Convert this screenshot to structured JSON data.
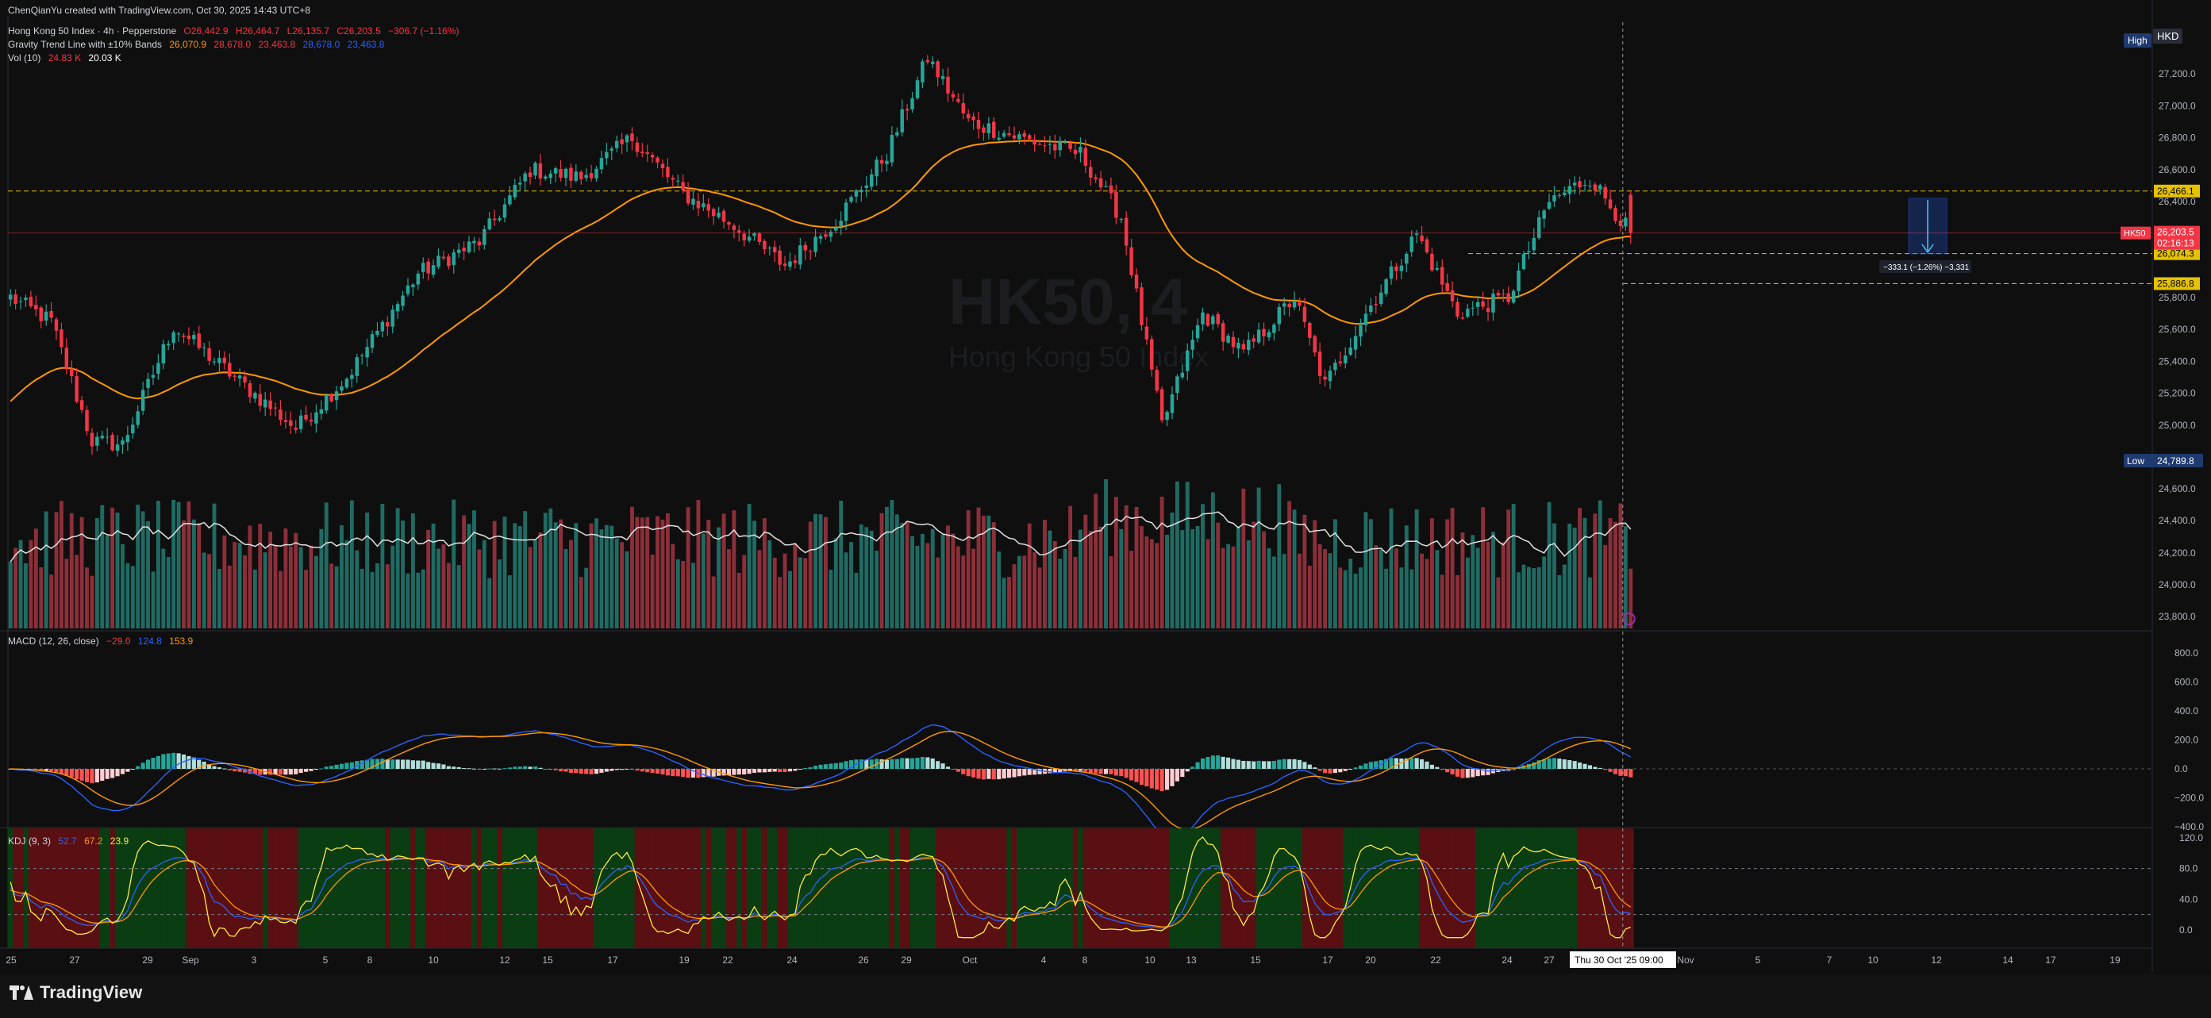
{
  "credit": "ChenQianYu created with TradingView.com, Oct 30, 2025 14:43 UTC+8",
  "brand": "TradingView",
  "header": {
    "symbol_line": "Hong Kong 50 Index · 4h · Pepperstone",
    "ohlc": {
      "o": "O26,442.9",
      "h": "H26,464.7",
      "l": "L26,135.7",
      "c": "C26,203.5",
      "chg": "−306.7 (−1.16%)"
    },
    "gravity_name": "Gravity Trend Line with ±10% Bands",
    "gravity_vals": [
      "26,070.9",
      "28,678.0",
      "23,463.8",
      "28,678.0",
      "23,463.8"
    ],
    "vol_name": "Vol (10)",
    "vol_vals": [
      "24.83 K",
      "20.03 K"
    ],
    "macd_name": "MACD (12, 26, close)",
    "macd_vals": [
      "−29.0",
      "124.8",
      "153.9"
    ],
    "kdj_name": "KDJ (9, 3)",
    "kdj_vals": [
      "52.7",
      "67.2",
      "23.9"
    ]
  },
  "watermark": {
    "symbol": "HK50, 4",
    "name": "Hong Kong 50 Index"
  },
  "price_axis": {
    "currency": "HKD",
    "high_label": "High",
    "low_label": "Low",
    "low_value": "24,789.8",
    "last_tag": "HK50",
    "last_price": "26,203.5",
    "countdown": "02:16:13",
    "lines": [
      {
        "label": "26,466.1",
        "value": 26466.1,
        "color": "#e6c200"
      },
      {
        "label": "26,074.3",
        "value": 26074.3,
        "color": "#e6c200"
      },
      {
        "label": "25,886.8",
        "value": 25886.8,
        "color": "#e6c200"
      }
    ],
    "ticks": [
      "27,200.0",
      "27,000.0",
      "26,800.0",
      "26,600.0",
      "26,400.0",
      "25,800.0",
      "25,600.0",
      "25,400.0",
      "25,200.0",
      "25,000.0",
      "24,600.0",
      "24,400.0",
      "24,200.0",
      "24,000.0",
      "23,800.0"
    ],
    "tick_values": [
      27200,
      27000,
      26800,
      26600,
      26400,
      25800,
      25600,
      25400,
      25200,
      25000,
      24600,
      24400,
      24200,
      24000,
      23800
    ]
  },
  "measure_label": "−333.1 (−1.26%) −3,331",
  "macd_axis": {
    "ticks": [
      "800.0",
      "600.0",
      "400.0",
      "200.0",
      "0.0",
      "−200.0",
      "−400.0"
    ],
    "values": [
      800,
      600,
      400,
      200,
      0,
      -200,
      -400
    ]
  },
  "kdj_axis": {
    "ticks": [
      "120.0",
      "80.0",
      "40.0",
      "0.0"
    ],
    "values": [
      120,
      80,
      40,
      0
    ]
  },
  "time_axis": {
    "labels": [
      "25",
      "27",
      "29",
      "Sep",
      "3",
      "5",
      "8",
      "10",
      "12",
      "15",
      "17",
      "19",
      "22",
      "24",
      "26",
      "29",
      "Oct",
      "4",
      "8",
      "10",
      "13",
      "15",
      "17",
      "20",
      "22",
      "24",
      "27",
      "Nov",
      "5",
      "7",
      "10",
      "12",
      "14",
      "17",
      "19"
    ],
    "cursor_label": "Thu 30 Oct '25   09:00"
  },
  "colors": {
    "up": "#26a69a",
    "down": "#f23645",
    "vol_up": "#1f6b63",
    "vol_down": "#8c2f39",
    "gravity": "#ff9800",
    "macd": "#2962ff",
    "signal": "#ff9800",
    "k": "#2962ff",
    "d": "#ff9800",
    "j": "#ffeb3b",
    "bg": "#0f0f0f",
    "kdj_bull": "#0b3d12",
    "kdj_bear": "#5a0f12"
  },
  "chart_data": {
    "type": "candlestick",
    "title": "Hong Kong 50 Index · 4h · Pepperstone",
    "keyframes": [
      {
        "i": 0,
        "p": 25800
      },
      {
        "i": 8,
        "p": 25650
      },
      {
        "i": 16,
        "p": 24900
      },
      {
        "i": 22,
        "p": 24880
      },
      {
        "i": 32,
        "p": 25620
      },
      {
        "i": 44,
        "p": 25300
      },
      {
        "i": 56,
        "p": 24980
      },
      {
        "i": 66,
        "p": 25300
      },
      {
        "i": 80,
        "p": 25950
      },
      {
        "i": 92,
        "p": 26150
      },
      {
        "i": 102,
        "p": 26600
      },
      {
        "i": 112,
        "p": 26550
      },
      {
        "i": 122,
        "p": 26800
      },
      {
        "i": 132,
        "p": 26450
      },
      {
        "i": 142,
        "p": 26250
      },
      {
        "i": 152,
        "p": 26000
      },
      {
        "i": 162,
        "p": 26280
      },
      {
        "i": 172,
        "p": 26700
      },
      {
        "i": 180,
        "p": 27300
      },
      {
        "i": 188,
        "p": 26900
      },
      {
        "i": 198,
        "p": 26800
      },
      {
        "i": 210,
        "p": 26700
      },
      {
        "i": 218,
        "p": 26300
      },
      {
        "i": 226,
        "p": 25000
      },
      {
        "i": 234,
        "p": 25700
      },
      {
        "i": 242,
        "p": 25450
      },
      {
        "i": 252,
        "p": 25800
      },
      {
        "i": 258,
        "p": 25250
      },
      {
        "i": 266,
        "p": 25700
      },
      {
        "i": 276,
        "p": 26200
      },
      {
        "i": 284,
        "p": 25700
      },
      {
        "i": 294,
        "p": 25800
      },
      {
        "i": 302,
        "p": 26400
      },
      {
        "i": 310,
        "p": 26550
      },
      {
        "i": 318,
        "p": 26203.5
      }
    ],
    "candle_count": 319,
    "ylim": [
      23700,
      27400
    ],
    "macd_range": [
      -400,
      800
    ],
    "kdj_range": [
      -10,
      125
    ]
  }
}
